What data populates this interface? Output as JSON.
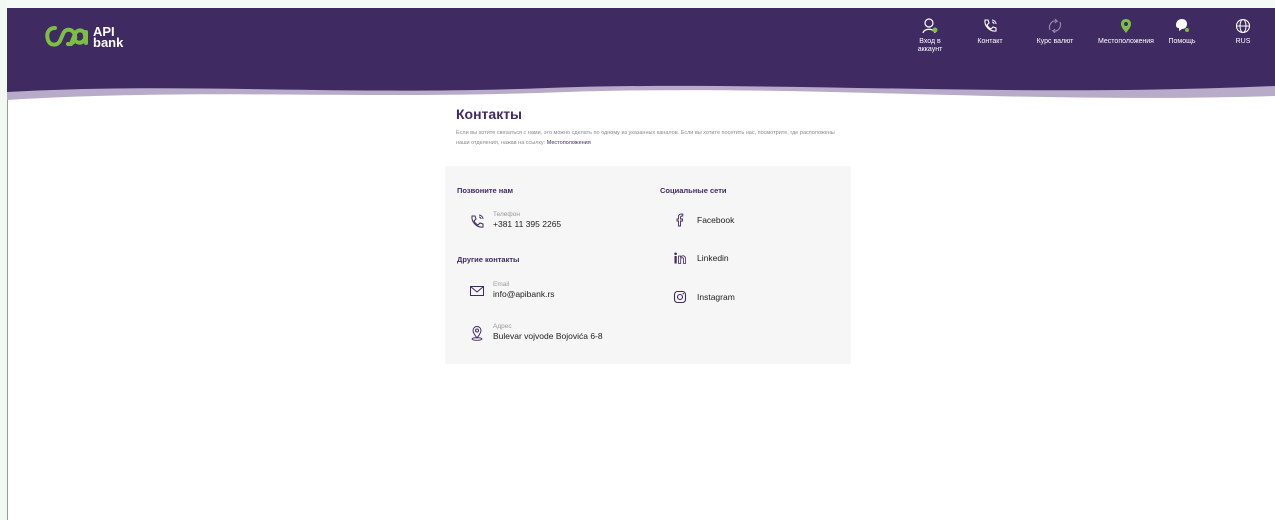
{
  "brand": {
    "line1": "API",
    "line2": "bank",
    "colors": {
      "primary": "#3f2a62",
      "accent": "#7bc043"
    }
  },
  "nav": [
    {
      "label_line1": "Вход в",
      "label_line2": "аккаунт",
      "icon": "user-icon"
    },
    {
      "label_line1": "Контакт",
      "label_line2": "",
      "icon": "phone-icon"
    },
    {
      "label_line1": "Курс валют",
      "label_line2": "",
      "icon": "exchange-icon"
    },
    {
      "label_line1": "Местоположения",
      "label_line2": "",
      "icon": "location-icon"
    },
    {
      "label_line1": "Помощь",
      "label_line2": "",
      "icon": "chat-icon"
    },
    {
      "label_line1": "RUS",
      "label_line2": "",
      "icon": "globe-icon"
    }
  ],
  "page": {
    "title": "Контакты",
    "intro": "Если вы хотите связаться с нами, это можно сделать по одному из указанных каналов. Если вы хотите посетить нас, посмотрите, где расположены наши отделения, нажав на ссылку:",
    "intro_link": "Местоположения"
  },
  "call": {
    "title": "Позвоните нам",
    "phone_label": "Телефон",
    "phone_value": "+381 11 395 2265"
  },
  "other": {
    "title": "Другие контакты",
    "email_label": "Email",
    "email_value": "info@apibank.rs",
    "address_label": "Адрес",
    "address_value": "Bulevar vojvode Bojovića 6-8"
  },
  "social": {
    "title": "Социальные сети",
    "items": [
      {
        "label": "Facebook",
        "icon": "facebook-icon"
      },
      {
        "label": "Linkedin",
        "icon": "linkedin-icon"
      },
      {
        "label": "Instagram",
        "icon": "instagram-icon"
      }
    ]
  }
}
